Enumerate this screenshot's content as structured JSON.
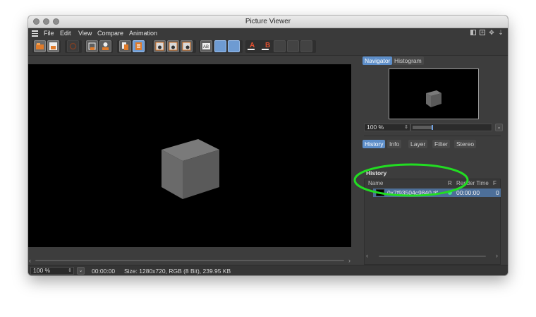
{
  "window": {
    "title": "Picture Viewer"
  },
  "menu": {
    "items": [
      "File",
      "Edit",
      "View",
      "Compare",
      "Animation"
    ]
  },
  "icons": {
    "hamburger": "hamburger-menu-icon",
    "right": [
      "panel-layout-icon",
      "expand-icon",
      "move-icon",
      "pin-icon"
    ]
  },
  "viewport": {
    "scene": "gray cube on black background"
  },
  "navigator": {
    "tabs": [
      "Navigator",
      "Histogram"
    ],
    "active_tab": "Navigator",
    "zoom_value": "100 %"
  },
  "history_panel": {
    "tabs": [
      "History",
      "Info",
      "Layer",
      "Filter",
      "Stereo"
    ],
    "active_tab": "History",
    "heading": "History",
    "columns": [
      "Name",
      "R",
      "Render Time",
      "F"
    ],
    "rows": [
      {
        "name": "0x7f93504c9840.tif",
        "status_color": "#3fe08a",
        "render_time": "00:00:00",
        "frame": "0"
      }
    ]
  },
  "statusbar": {
    "zoom_value": "100 %",
    "time": "00:00:00",
    "info": "Size: 1280x720, RGB (8 Bit), 239.95 KB"
  },
  "colors": {
    "accent": "#5d8ec9",
    "annotation": "#22dd22",
    "background": "#3d3d3d"
  }
}
